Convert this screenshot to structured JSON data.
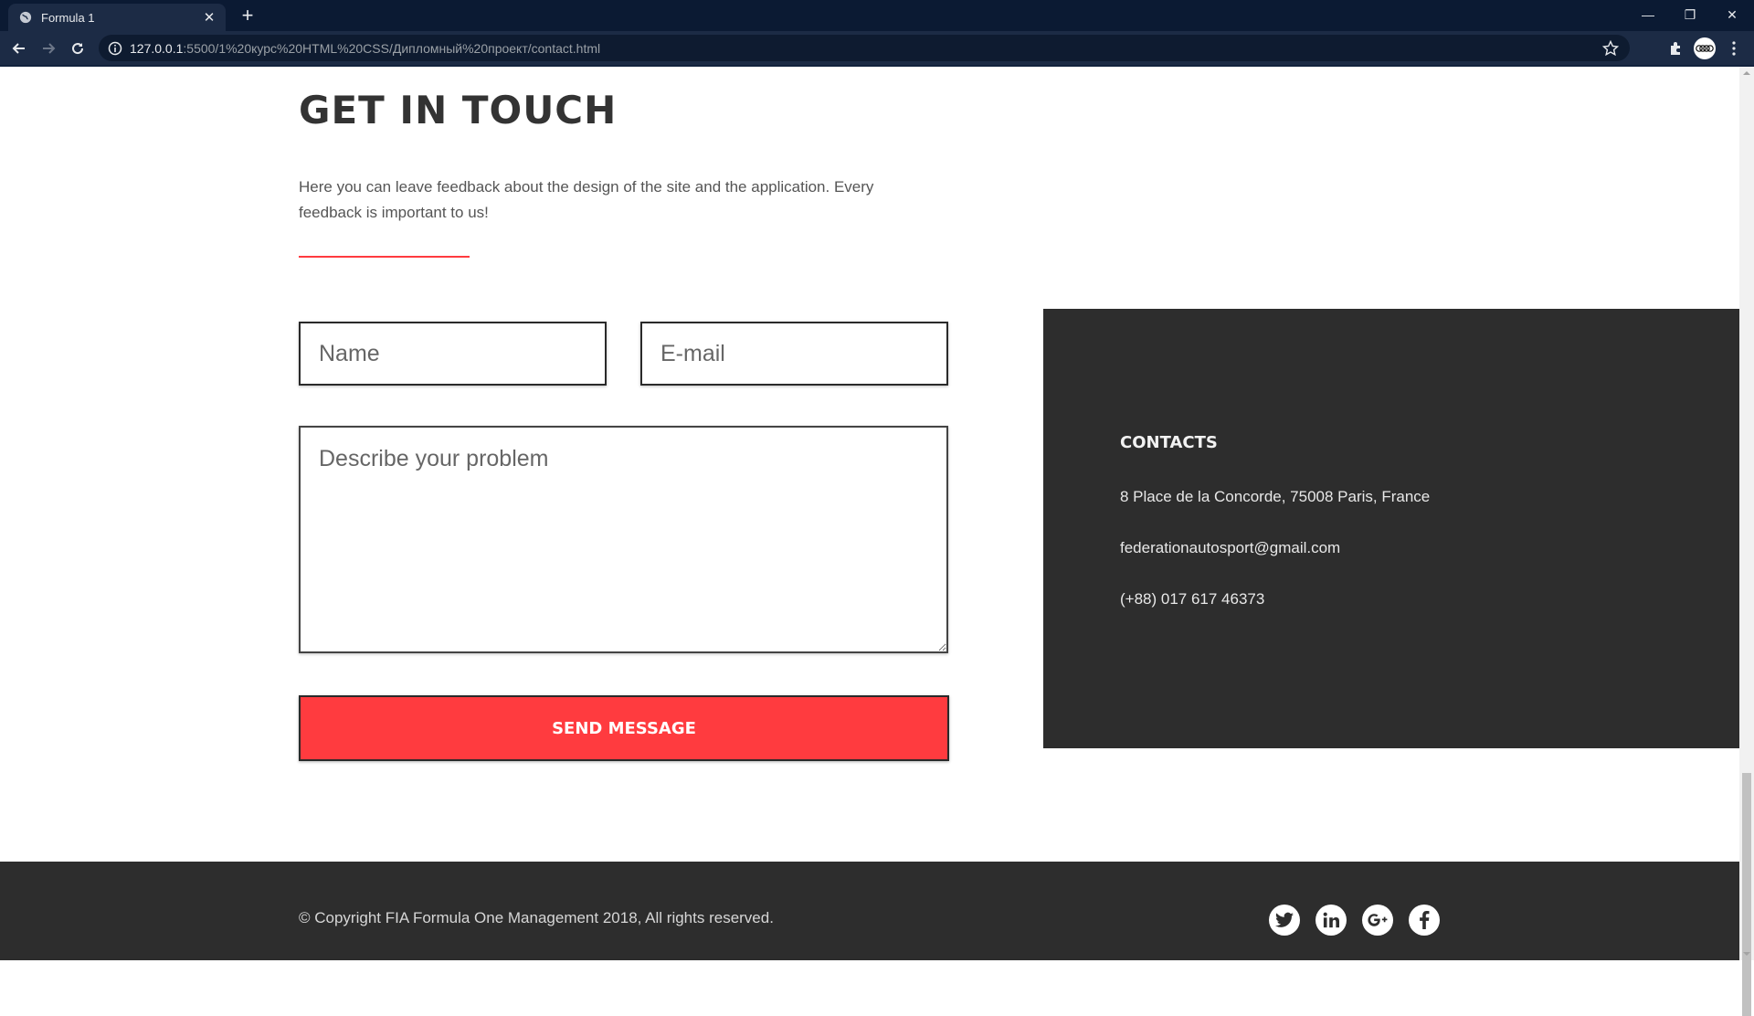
{
  "browser": {
    "tab_title": "Formula 1",
    "tab_close": "✕",
    "new_tab": "+",
    "url_host": "127.0.0.1",
    "url_path": ":5500/1%20курс%20HTML%20CSS/Дипломный%20проект/contact.html",
    "window_minimize": "—",
    "window_restore": "❐",
    "window_close": "✕"
  },
  "page": {
    "heading": "GET IN TOUCH",
    "intro": "Here you can leave feedback about the design of the site and the application. Every feedback is important to us!",
    "accent_color": "#ff3b3f"
  },
  "form": {
    "name_placeholder": "Name",
    "email_placeholder": "E-mail",
    "problem_placeholder": "Describe your problem",
    "send_label": "SEND MESSAGE"
  },
  "contacts": {
    "title": "CONTACTS",
    "address": "8 Place de la Concorde, 75008 Paris, France",
    "email": "federationautosport@gmail.com",
    "phone": "(+88) 017 617 46373"
  },
  "footer": {
    "copyright": "© Copyright FIA Formula One Management 2018, All rights reserved.",
    "social_icons": [
      "twitter-icon",
      "linkedin-icon",
      "google-plus-icon",
      "facebook-icon"
    ]
  }
}
